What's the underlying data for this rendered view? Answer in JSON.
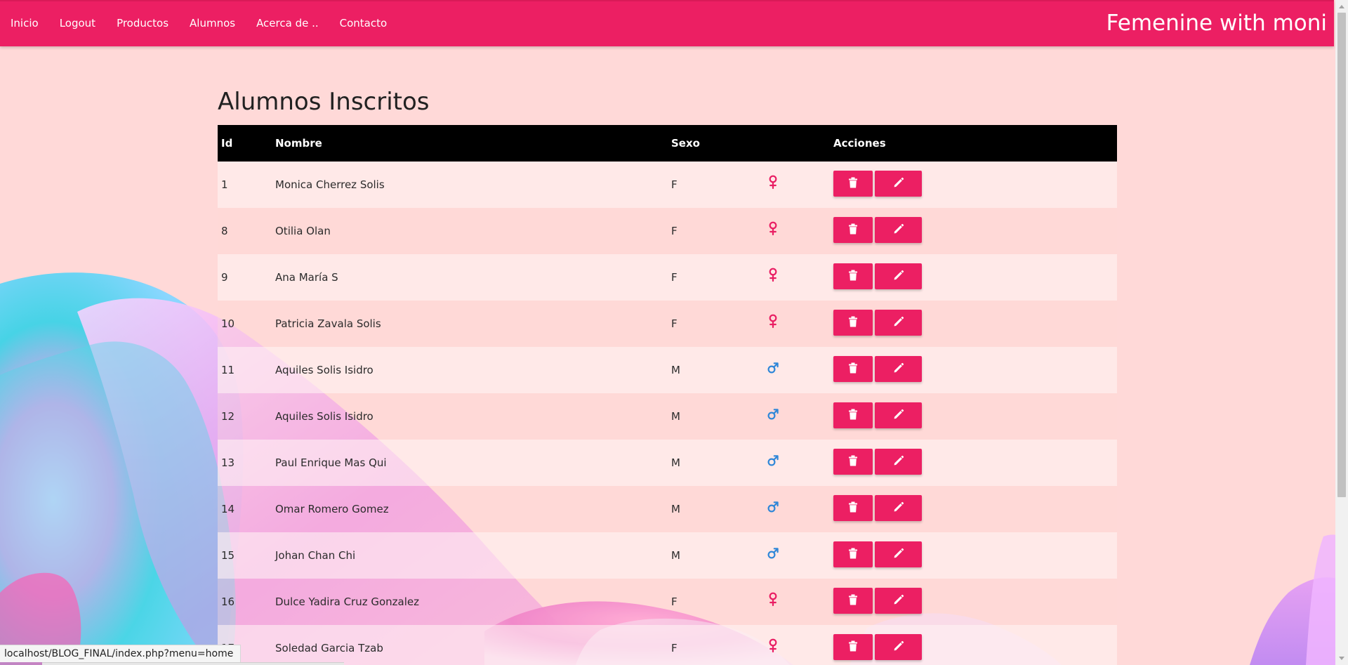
{
  "nav": {
    "items": [
      "Inicio",
      "Logout",
      "Productos",
      "Alumnos",
      "Acerca de ..",
      "Contacto"
    ],
    "brand": "Femenine with moni"
  },
  "page": {
    "title": "Alumnos Inscritos"
  },
  "table": {
    "headers": {
      "id": "Id",
      "nombre": "Nombre",
      "sexo": "Sexo",
      "icono": "",
      "acciones": "Acciones"
    },
    "rows": [
      {
        "id": "1",
        "nombre": "Monica Cherrez Solis",
        "sexo": "F",
        "icon": "female-icon"
      },
      {
        "id": "8",
        "nombre": "Otilia Olan",
        "sexo": "F",
        "icon": "female-icon"
      },
      {
        "id": "9",
        "nombre": "Ana María S",
        "sexo": "F",
        "icon": "female-icon"
      },
      {
        "id": "10",
        "nombre": "Patricia Zavala Solis",
        "sexo": "F",
        "icon": "female-icon"
      },
      {
        "id": "11",
        "nombre": "Aquiles Solis Isidro",
        "sexo": "M",
        "icon": "male-icon"
      },
      {
        "id": "12",
        "nombre": "Aquiles Solis Isidro",
        "sexo": "M",
        "icon": "male-icon"
      },
      {
        "id": "13",
        "nombre": "Paul Enrique Mas Qui",
        "sexo": "M",
        "icon": "male-icon"
      },
      {
        "id": "14",
        "nombre": "Omar Romero Gomez",
        "sexo": "M",
        "icon": "male-icon"
      },
      {
        "id": "15",
        "nombre": "Johan Chan Chi",
        "sexo": "M",
        "icon": "male-icon"
      },
      {
        "id": "16",
        "nombre": "Dulce Yadira Cruz Gonzalez",
        "sexo": "F",
        "icon": "female-icon"
      },
      {
        "id": "17",
        "nombre": "Soledad Garcia Tzab",
        "sexo": "F",
        "icon": "female-icon"
      }
    ],
    "action_icons": [
      "trash-icon",
      "pencil-icon"
    ]
  },
  "status_bar": {
    "url": "localhost/BLOG_FINAL/index.php?menu=home"
  },
  "colors": {
    "primary": "#ec1f63",
    "page_bg": "#ffd9d8",
    "header_bg": "#000000",
    "female_icon": "#e91e63",
    "male_icon": "#2f87d8"
  }
}
